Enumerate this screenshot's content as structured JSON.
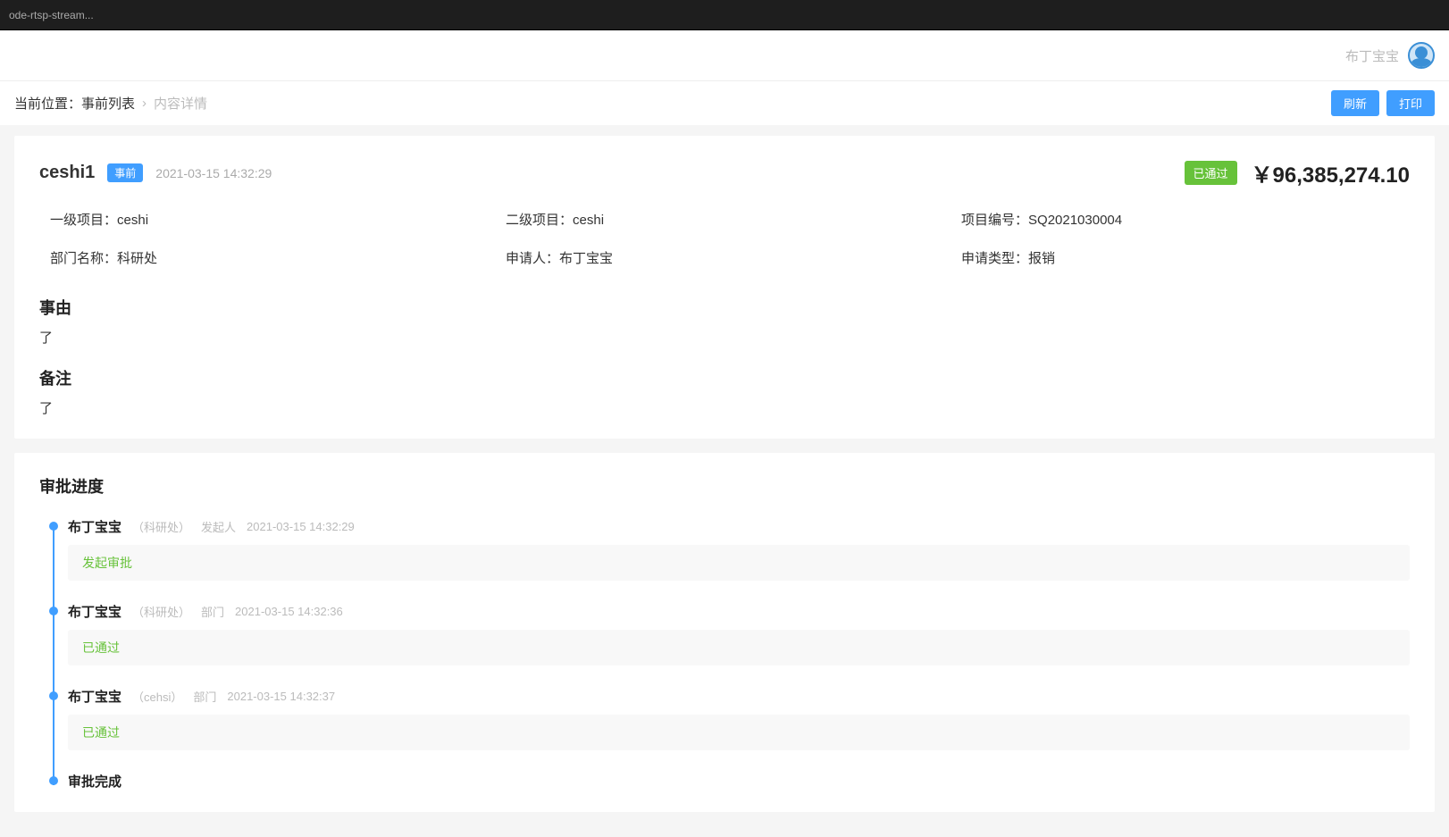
{
  "titlebar": {
    "text": "ode-rtsp-stream..."
  },
  "header": {
    "user_name": "布丁宝宝"
  },
  "breadcrumb": {
    "prefix": "当前位置：",
    "root": "事前列表",
    "current": "内容详情"
  },
  "actions": {
    "refresh": "刷新",
    "print": "打印"
  },
  "summary": {
    "title": "ceshi1",
    "tag": "事前",
    "created_at": "2021-03-15 14:32:29",
    "status": "已通过",
    "amount": "￥96,385,274.10",
    "fields": {
      "level1_label": "一级项目：",
      "level1_value": "ceshi",
      "level2_label": "二级项目：",
      "level2_value": "ceshi",
      "code_label": "项目编号：",
      "code_value": "SQ2021030004",
      "dept_label": "部门名称：",
      "dept_value": "科研处",
      "applicant_label": "申请人：",
      "applicant_value": "布丁宝宝",
      "type_label": "申请类型：",
      "type_value": "报销"
    }
  },
  "reason": {
    "title": "事由",
    "body": "了"
  },
  "remark": {
    "title": "备注",
    "body": "了"
  },
  "progress": {
    "title": "审批进度",
    "steps": [
      {
        "name": "布丁宝宝",
        "dept": "（科研处）",
        "role": "发起人",
        "time": "2021-03-15 14:32:29",
        "status": "发起审批"
      },
      {
        "name": "布丁宝宝",
        "dept": "（科研处）",
        "role": "部门",
        "time": "2021-03-15 14:32:36",
        "status": "已通过"
      },
      {
        "name": "布丁宝宝",
        "dept": "（cehsi）",
        "role": "部门",
        "time": "2021-03-15 14:32:37",
        "status": "已通过"
      }
    ],
    "final": "审批完成"
  }
}
